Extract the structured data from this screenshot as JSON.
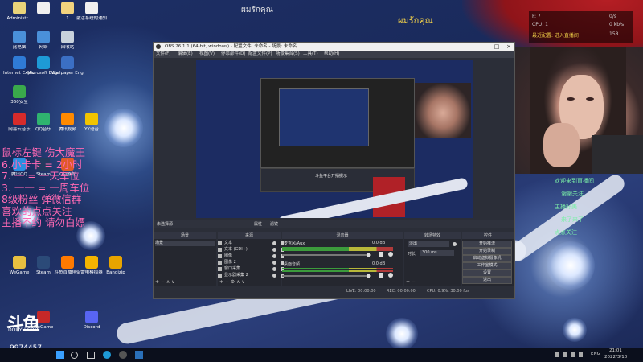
{
  "top_text": "ผมรักคุณ",
  "top_text2": "ผมรักคุณ",
  "desktop_icons": [
    {
      "label": "Administr...",
      "color": "#e9d47a"
    },
    {
      "label": "",
      "color": "#f0f0f0"
    },
    {
      "label": "1",
      "color": "#f2d37e"
    },
    {
      "label": "激活系统的通知",
      "color": "#f0f0f0"
    },
    {
      "label": "此电脑",
      "color": "#4a90d9"
    },
    {
      "label": "网络",
      "color": "#4a90d9"
    },
    {
      "label": "回收站",
      "color": "#c8d2dc"
    },
    {
      "label": "Internet Explorer",
      "color": "#2f7bd6"
    },
    {
      "label": "Microsoft Edge",
      "color": "#1e9ad6"
    },
    {
      "label": "Wallpaper Engine",
      "color": "#3b6fc4"
    },
    {
      "label": "360安全",
      "color": "#3aa94b"
    },
    {
      "label": "网易云音乐",
      "color": "#d62b2b"
    },
    {
      "label": "QQ音乐",
      "color": "#2fb36f"
    },
    {
      "label": "腾讯视频",
      "color": "#ff8a00"
    },
    {
      "label": "YY语音",
      "color": "#f2c400"
    },
    {
      "label": "腾讯QQ",
      "color": "#2a8fe0"
    },
    {
      "label": "Steam",
      "color": "#233a5e"
    },
    {
      "label": "QQ游戏",
      "color": "#e05a2a"
    },
    {
      "label": "WeGame",
      "color": "#e8c040"
    },
    {
      "label": "Steam",
      "color": "#2b4a78"
    },
    {
      "label": "斗鱼直播伴侣",
      "color": "#ff7a00"
    },
    {
      "label": "雷电模拟器",
      "color": "#f4b400"
    },
    {
      "label": "Bandizip",
      "color": "#e8a400"
    },
    {
      "label": "WeGame",
      "color": "#c62828"
    },
    {
      "label": "Discord",
      "color": "#5865f2"
    }
  ],
  "overlay_lines": [
    "鼠标左键 伤大魔王",
    "6.小卡卡 = 2小时",
    "7. 一 = 一天车位",
    "3. 一一 = 一周车位",
    "8级粉丝 弹微信群",
    "喜欢的点点关注",
    "主播不约 请勿白嫖"
  ],
  "stats_overlay": {
    "line1": "F: 7",
    "line2": "CPU: 1",
    "line3": "最近配置: 进入直播间",
    "right1": "0/s",
    "right2": "0 kb/s",
    "right3": "158"
  },
  "obs": {
    "title": "OBS 26.1.1 (64-bit, windows) - 配置文件: 未命名 - 场景: 未命名",
    "menu": [
      "文件(F)",
      "编辑(E)",
      "视图(V)",
      "停靠部件(D)",
      "配置文件(P)",
      "场景集合(S)",
      "工具(T)",
      "帮助(H)"
    ],
    "preview_text": "斗鱼平台开播提示",
    "source_bar": {
      "left": "未选择源",
      "btn1": "属性",
      "btn2": "滤镜"
    },
    "docks": [
      "场景",
      "来源",
      "混音器",
      "转场特效",
      "控件"
    ],
    "scene_item": "场景",
    "sources": [
      "文本",
      "文本 (GDI+)",
      "图像",
      "图像 2",
      "窗口采集",
      "显示器采集 2"
    ],
    "mixer": [
      {
        "name": "麦克风/Aux",
        "level": "0.0 dB"
      },
      {
        "name": "桌面音频",
        "level": "0.0 dB"
      }
    ],
    "transition": {
      "type": "淡出",
      "duration_label": "时长",
      "duration": "300 ms"
    },
    "controls": [
      "开始推流",
      "开始录制",
      "启动虚拟摄像机",
      "工作室模式",
      "设置",
      "退出"
    ],
    "status": {
      "live": "LIVE: 00:00:00",
      "rec": "REC: 00:00:00",
      "cpu": "CPU: 0.9%, 30.00 fps"
    }
  },
  "logo": {
    "big": "斗鱼",
    "small": "DOUYU.COM"
  },
  "room_id": "9974457",
  "taskbar": {
    "lang": "ENG",
    "time": "21:01",
    "date": "2022/3/10"
  },
  "chat_lines": [
    "欢迎来到直播间",
    "谢谢关注",
    "主播好美",
    "来了来了",
    "点点关注"
  ]
}
